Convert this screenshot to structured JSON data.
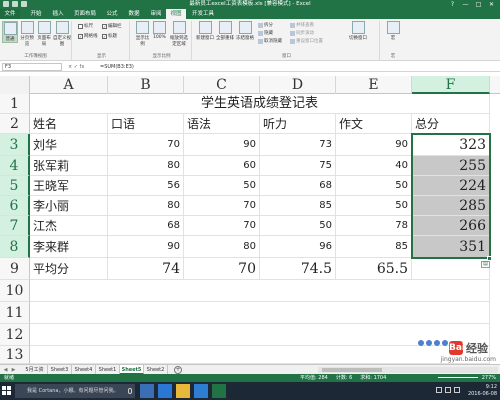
{
  "window": {
    "title": "最新员工excel工资表模板.xls [兼容模式] - Excel",
    "controls": [
      "?",
      "—",
      "□",
      "✕"
    ]
  },
  "tabs": [
    "文件",
    "开始",
    "插入",
    "页面布局",
    "公式",
    "数据",
    "审阅",
    "视图",
    "开发工具"
  ],
  "active_tab": "视图",
  "ribbon": {
    "views_group": {
      "label": "工作簿视图",
      "buttons": [
        "普通",
        "分页预览",
        "页面布局",
        "自定义视图"
      ]
    },
    "show_group": {
      "label": "显示",
      "checks": [
        {
          "label": "标尺",
          "checked": false
        },
        {
          "label": "编辑栏",
          "checked": true
        },
        {
          "label": "网格线",
          "checked": true
        },
        {
          "label": "标题",
          "checked": true
        }
      ]
    },
    "zoom_group": {
      "label": "显示比例",
      "buttons": [
        "显示比例",
        "100%",
        "缩放到选定区域"
      ]
    },
    "window_group": {
      "label": "窗口",
      "buttons": [
        "新建窗口",
        "全部重排",
        "冻结窗格"
      ],
      "small": [
        "拆分",
        "隐藏",
        "取消隐藏",
        "并排查看",
        "同步滚动",
        "重设窗口位置"
      ],
      "switch": "切换窗口"
    },
    "macro_group": {
      "label": "宏",
      "buttons": [
        "宏"
      ]
    }
  },
  "formula_bar": {
    "name_box": "F3",
    "fx": "× ✓ fx",
    "formula": "=SUM(B3:E3)"
  },
  "sheet": {
    "columns": [
      "A",
      "B",
      "C",
      "D",
      "E",
      "F"
    ],
    "selected_column": "F",
    "row_numbers": [
      "1",
      "2",
      "3",
      "4",
      "5",
      "6",
      "7",
      "8",
      "9",
      "10",
      "11",
      "12",
      "13"
    ],
    "selected_rows": [
      "3",
      "4",
      "5",
      "6",
      "7",
      "8"
    ],
    "title": "学生英语成绩登记表",
    "headers": [
      "姓名",
      "口语",
      "语法",
      "听力",
      "作文",
      "总分"
    ],
    "rows": [
      {
        "name": "刘华",
        "oral": "70",
        "grammar": "90",
        "listening": "73",
        "writing": "90",
        "total": "323"
      },
      {
        "name": "张军莉",
        "oral": "80",
        "grammar": "60",
        "listening": "75",
        "writing": "40",
        "total": "255"
      },
      {
        "name": "王晓军",
        "oral": "56",
        "grammar": "50",
        "listening": "68",
        "writing": "50",
        "total": "224"
      },
      {
        "name": "李小丽",
        "oral": "80",
        "grammar": "70",
        "listening": "85",
        "writing": "50",
        "total": "285"
      },
      {
        "name": "江杰",
        "oral": "68",
        "grammar": "70",
        "listening": "50",
        "writing": "78",
        "total": "266"
      },
      {
        "name": "李来群",
        "oral": "90",
        "grammar": "80",
        "listening": "96",
        "writing": "85",
        "total": "351"
      }
    ],
    "average": {
      "label": "平均分",
      "oral": "74",
      "grammar": "70",
      "listening": "74.5",
      "writing": "65.5"
    }
  },
  "sheet_tabs": {
    "tabs": [
      "5月工资",
      "Sheet3",
      "Sheet4",
      "Sheet1",
      "Sheet5",
      "Sheet2"
    ],
    "active": "Sheet5",
    "add": "+"
  },
  "status_bar": {
    "ready": "就绪",
    "average": "平均值: 284",
    "count": "计数: 6",
    "sum": "求和: 1704",
    "zoom": "277%"
  },
  "watermark": {
    "badge": "Bai",
    "text": "经验",
    "url": "jingyan.baidu.com"
  },
  "taskbar": {
    "search_placeholder": "我是 Cortana，小娜。有问题尽管问我。",
    "time": "9:12",
    "date": "2016-06-08"
  },
  "colors": {
    "excel_green": "#217346",
    "selection_fill": "#c8c8c8",
    "header_selected": "#d3f0e0"
  }
}
